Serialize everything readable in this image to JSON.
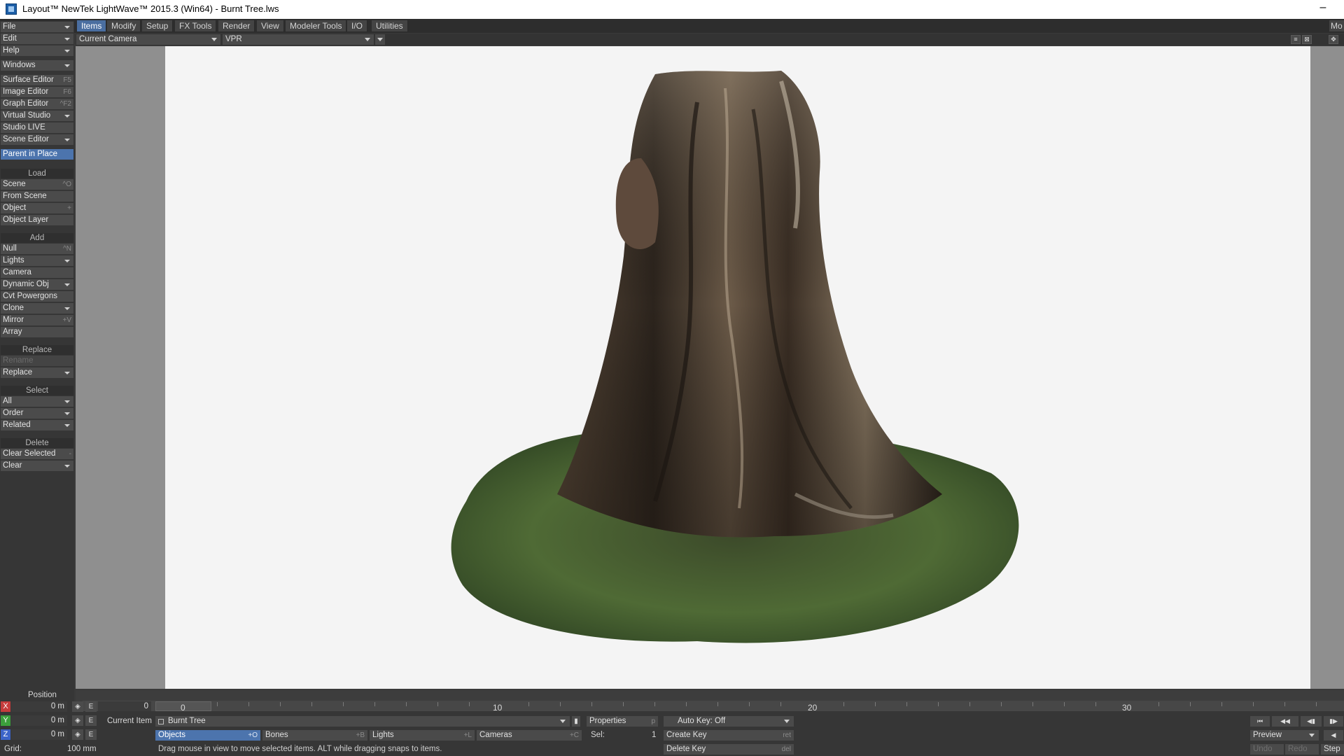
{
  "window": {
    "title": "Layout™ NewTek LightWave™ 2015.3 (Win64) - Burnt Tree.lws",
    "minimize": "–"
  },
  "tabs": [
    "Items",
    "Modify",
    "Setup",
    "FX Tools",
    "Render",
    "View",
    "Modeler Tools",
    "I/O",
    "Utilities"
  ],
  "tab_right": "Mo",
  "left": {
    "file": "File",
    "edit": "Edit",
    "help": "Help",
    "windows": "Windows",
    "surface_editor": "Surface Editor",
    "surface_editor_sc": "F5",
    "image_editor": "Image Editor",
    "image_editor_sc": "F6",
    "graph_editor": "Graph Editor",
    "graph_editor_sc": "^F2",
    "virtual_studio": "Virtual Studio",
    "studio_live": "Studio LIVE",
    "scene_editor": "Scene Editor",
    "parent_in_place": "Parent in Place",
    "load_head": "Load",
    "scene": "Scene",
    "scene_sc": "^O",
    "from_scene": "From Scene",
    "object": "Object",
    "object_sc": "+",
    "object_layer": "Object Layer",
    "add_head": "Add",
    "null": "Null",
    "null_sc": "^N",
    "lights": "Lights",
    "camera": "Camera",
    "dynamic_obj": "Dynamic Obj",
    "cvt_powergons": "Cvt Powergons",
    "clone": "Clone",
    "mirror": "Mirror",
    "mirror_sc": "+V",
    "array": "Array",
    "replace_head": "Replace",
    "rename": "Rename",
    "replace": "Replace",
    "select_head": "Select",
    "all": "All",
    "order": "Order",
    "related": "Related",
    "delete_head": "Delete",
    "clear_selected": "Clear Selected",
    "clear_selected_sc": "-",
    "clear": "Clear"
  },
  "viewport": {
    "camera": "Current Camera",
    "mode": "VPR"
  },
  "timeline": {
    "frame": "0",
    "cursor": "0",
    "marks": [
      "10",
      "20",
      "30"
    ]
  },
  "bottom": {
    "position_label": "Position",
    "x_label": "X",
    "x_val": "0 m",
    "y_label": "Y",
    "y_val": "0 m",
    "z_label": "Z",
    "z_val": "0 m",
    "e": "E",
    "grid_label": "Grid:",
    "grid_val": "100 mm",
    "current_item_label": "Current Item",
    "current_item": "Burnt Tree",
    "properties": "Properties",
    "properties_sc": "p",
    "auto_key": "Auto Key: Off",
    "objects": "Objects",
    "objects_sc": "+O",
    "bones": "Bones",
    "bones_sc": "+B",
    "lights": "Lights",
    "lights_sc": "+L",
    "cameras": "Cameras",
    "cameras_sc": "+C",
    "sel_label": "Sel:",
    "sel_val": "1",
    "create_key": "Create Key",
    "create_key_sc": "ret",
    "delete_key": "Delete Key",
    "delete_key_sc": "del",
    "status": "Drag mouse in view to move selected items. ALT while dragging snaps to items.",
    "preview": "Preview",
    "undo": "Undo",
    "redo": "Redo",
    "step": "Step"
  },
  "colors": {
    "accent": "#4c74ad",
    "x_axis": "#c63c3c",
    "y_axis": "#3ca03c",
    "z_axis": "#3c64c8"
  }
}
